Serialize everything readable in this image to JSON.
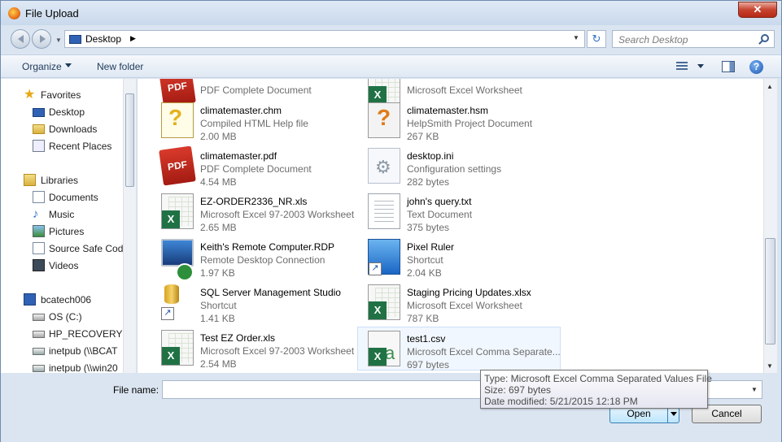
{
  "window": {
    "title": "File Upload",
    "close_glyph": "✕"
  },
  "address": {
    "location": "Desktop",
    "separator": "▶"
  },
  "search": {
    "placeholder": "Search Desktop"
  },
  "toolbar": {
    "organize": "Organize",
    "new_folder": "New folder",
    "help": "?"
  },
  "sidebar": {
    "items": [
      {
        "label": "Favorites",
        "icon": "star-icon"
      },
      {
        "label": "Desktop",
        "icon": "desktop-icon"
      },
      {
        "label": "Downloads",
        "icon": "downloads-icon"
      },
      {
        "label": "Recent Places",
        "icon": "recent-places-icon"
      },
      {
        "label": "Libraries",
        "icon": "libraries-icon"
      },
      {
        "label": "Documents",
        "icon": "documents-icon"
      },
      {
        "label": "Music",
        "icon": "music-icon"
      },
      {
        "label": "Pictures",
        "icon": "pictures-icon"
      },
      {
        "label": "Source Safe Code",
        "icon": "library-icon"
      },
      {
        "label": "Videos",
        "icon": "videos-icon"
      },
      {
        "label": "bcatech006",
        "icon": "computer-icon"
      },
      {
        "label": "OS (C:)",
        "icon": "drive-icon"
      },
      {
        "label": "HP_RECOVERY (D",
        "icon": "drive-icon"
      },
      {
        "label": "inetpub (\\\\BCAT",
        "icon": "network-drive-icon"
      },
      {
        "label": "inetpub (\\\\win20",
        "icon": "network-drive-icon"
      }
    ]
  },
  "files": [
    {
      "name": "",
      "type": "PDF Complete Document",
      "size": "",
      "icon": "pdf-icon"
    },
    {
      "name": "",
      "type": "Microsoft Excel Worksheet",
      "size": "",
      "icon": "excel-icon"
    },
    {
      "name": "climatemaster.chm",
      "type": "Compiled HTML Help file",
      "size": "2.00 MB",
      "icon": "help-file-icon"
    },
    {
      "name": "climatemaster.hsm",
      "type": "HelpSmith Project Document",
      "size": "267 KB",
      "icon": "helpsmith-icon"
    },
    {
      "name": "climatemaster.pdf",
      "type": "PDF Complete Document",
      "size": "4.54 MB",
      "icon": "pdf-icon"
    },
    {
      "name": "desktop.ini",
      "type": "Configuration settings",
      "size": "282 bytes",
      "icon": "settings-file-icon"
    },
    {
      "name": "EZ-ORDER2336_NR.xls",
      "type": "Microsoft Excel 97-2003 Worksheet",
      "size": "2.65 MB",
      "icon": "excel-icon"
    },
    {
      "name": "john's query.txt",
      "type": "Text Document",
      "size": "375 bytes",
      "icon": "text-file-icon"
    },
    {
      "name": "Keith's Remote Computer.RDP",
      "type": "Remote Desktop Connection",
      "size": "1.97 KB",
      "icon": "remote-desktop-icon"
    },
    {
      "name": "Pixel Ruler",
      "type": "Shortcut",
      "size": "2.04 KB",
      "icon": "shortcut-icon"
    },
    {
      "name": "SQL Server Management Studio",
      "type": "Shortcut",
      "size": "1.41 KB",
      "icon": "sql-shortcut-icon"
    },
    {
      "name": "Staging Pricing Updates.xlsx",
      "type": "Microsoft Excel Worksheet",
      "size": "787 KB",
      "icon": "excel-icon"
    },
    {
      "name": "Test EZ Order.xls",
      "type": "Microsoft Excel 97-2003 Worksheet",
      "size": "2.54 MB",
      "icon": "excel-icon"
    },
    {
      "name": "test1.csv",
      "type": "Microsoft Excel Comma Separate...",
      "size": "697 bytes",
      "icon": "csv-icon"
    }
  ],
  "filename": {
    "label": "File name:",
    "value": ""
  },
  "buttons": {
    "open": "Open",
    "cancel": "Cancel"
  },
  "tooltip": {
    "type": "Type: Microsoft Excel Comma Separated Values File",
    "size": "Size: 697 bytes",
    "modified": "Date modified: 5/21/2015 12:18 PM"
  }
}
